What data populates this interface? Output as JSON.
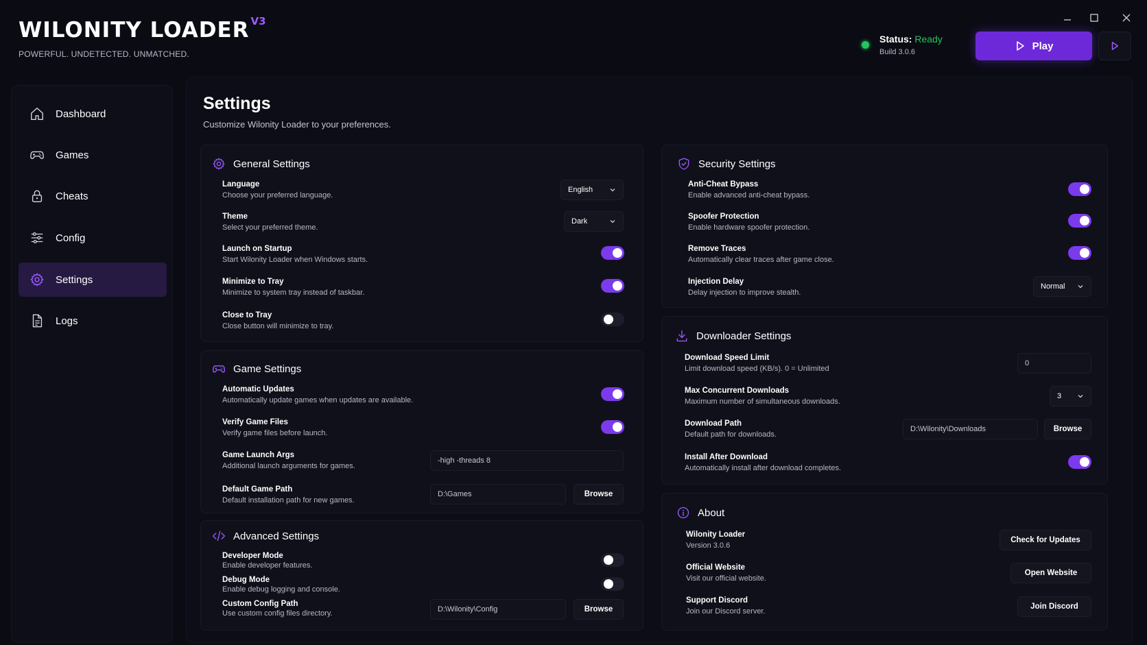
{
  "app": {
    "title": "WILONITY LOADER",
    "version_badge": "V3",
    "tagline": "POWERFUL. UNDETECTED. UNMATCHED."
  },
  "status": {
    "label": "Status:",
    "value": "Ready",
    "build": "Build 3.0.6",
    "color": "#22c55e"
  },
  "actions": {
    "play_label": "Play"
  },
  "sidebar": {
    "items": [
      {
        "label": "Dashboard",
        "icon": "home-icon"
      },
      {
        "label": "Games",
        "icon": "gamepad-icon"
      },
      {
        "label": "Cheats",
        "icon": "lock-icon"
      },
      {
        "label": "Config",
        "icon": "sliders-icon"
      },
      {
        "label": "Settings",
        "icon": "gear-icon",
        "active": true
      },
      {
        "label": "Logs",
        "icon": "file-icon"
      }
    ]
  },
  "page": {
    "title": "Settings",
    "subtitle": "Customize Wilonity Loader to your preferences."
  },
  "general": {
    "title": "General Settings",
    "language": {
      "label": "Language",
      "desc": "Choose your preferred language.",
      "value": "English"
    },
    "theme": {
      "label": "Theme",
      "desc": "Select your preferred theme.",
      "value": "Dark"
    },
    "launch_startup": {
      "label": "Launch on Startup",
      "desc": "Start Wilonity Loader when Windows starts.",
      "on": true
    },
    "minimize_tray": {
      "label": "Minimize to Tray",
      "desc": "Minimize to system tray instead of taskbar.",
      "on": true
    },
    "close_tray": {
      "label": "Close to Tray",
      "desc": "Close button will minimize to tray.",
      "on": false
    }
  },
  "game": {
    "title": "Game Settings",
    "auto_updates": {
      "label": "Automatic Updates",
      "desc": "Automatically update games when updates are available.",
      "on": true
    },
    "verify_files": {
      "label": "Verify Game Files",
      "desc": "Verify game files before launch.",
      "on": true
    },
    "launch_args": {
      "label": "Game Launch Args",
      "desc": "Additional launch arguments for games.",
      "value": "-high -threads 8"
    },
    "default_path": {
      "label": "Default Game Path",
      "desc": "Default installation path for new games.",
      "value": "D:\\Games",
      "button": "Browse"
    }
  },
  "advanced": {
    "title": "Advanced Settings",
    "developer_mode": {
      "label": "Developer Mode",
      "desc": "Enable developer features.",
      "on": false
    },
    "debug_mode": {
      "label": "Debug Mode",
      "desc": "Enable debug logging and console.",
      "on": false
    },
    "config_path": {
      "label": "Custom Config Path",
      "desc": "Use custom config files directory.",
      "value": "D:\\Wilonity\\Config",
      "button": "Browse"
    }
  },
  "security": {
    "title": "Security Settings",
    "anticheat": {
      "label": "Anti-Cheat Bypass",
      "desc": "Enable advanced anti-cheat bypass.",
      "on": true
    },
    "spoofer": {
      "label": "Spoofer Protection",
      "desc": "Enable hardware spoofer protection.",
      "on": true
    },
    "traces": {
      "label": "Remove Traces",
      "desc": "Automatically clear traces after game close.",
      "on": true
    },
    "injection_delay": {
      "label": "Injection Delay",
      "desc": "Delay injection to improve stealth.",
      "value": "Normal"
    }
  },
  "downloader": {
    "title": "Downloader Settings",
    "speed_limit": {
      "label": "Download Speed Limit",
      "desc": "Limit download speed (KB/s). 0 = Unlimited",
      "value": "0"
    },
    "concurrent": {
      "label": "Max Concurrent Downloads",
      "desc": "Maximum number of simultaneous downloads.",
      "value": "3"
    },
    "path": {
      "label": "Download Path",
      "desc": "Default path for downloads.",
      "value": "D:\\Wilonity\\Downloads",
      "button": "Browse"
    },
    "install_after": {
      "label": "Install After Download",
      "desc": "Automatically install after download completes.",
      "on": true
    }
  },
  "about": {
    "title": "About",
    "loader": {
      "label": "Wilonity Loader",
      "desc": "Version 3.0.6",
      "button": "Check for Updates"
    },
    "website": {
      "label": "Official Website",
      "desc": "Visit our official website.",
      "button": "Open Website"
    },
    "discord": {
      "label": "Support Discord",
      "desc": "Join our Discord server.",
      "button": "Join Discord"
    }
  },
  "colors": {
    "accent": "#7c3aed",
    "background": "#0b0b14",
    "panel": "#10101b",
    "ready": "#22c55e"
  }
}
